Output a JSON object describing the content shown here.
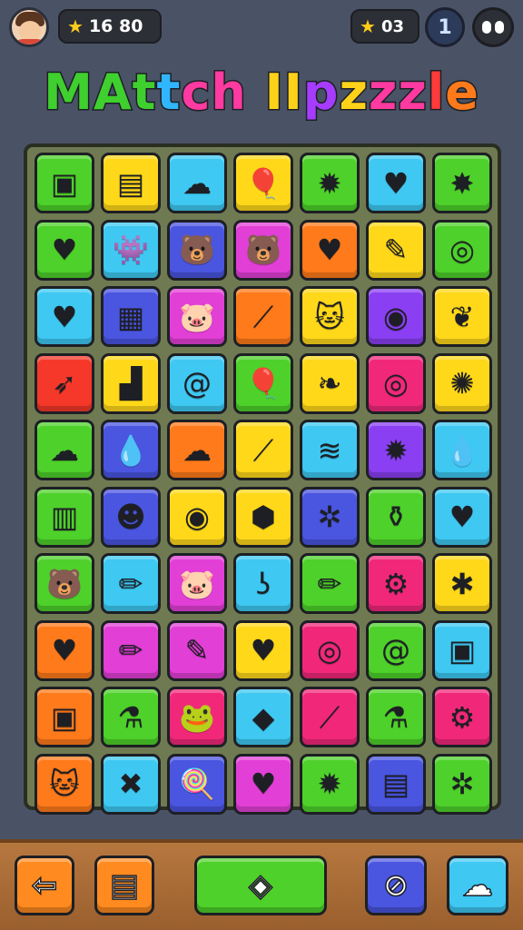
{
  "hud": {
    "score_text": "16 80",
    "stars_text": "03",
    "level_text": "1"
  },
  "title": {
    "letters": [
      {
        "ch": "M",
        "color": "#3fcf2f"
      },
      {
        "ch": "A",
        "color": "#3fcf2f"
      },
      {
        "ch": "t",
        "color": "#3fcf2f"
      },
      {
        "ch": "t",
        "color": "#2fb6ff"
      },
      {
        "ch": "c",
        "color": "#ff3aa0"
      },
      {
        "ch": "h",
        "color": "#ff3aa0"
      },
      {
        "ch": " ",
        "color": "#ffffff"
      },
      {
        "ch": "I",
        "color": "#ffd21a"
      },
      {
        "ch": "I",
        "color": "#ffd21a"
      },
      {
        "ch": "p",
        "color": "#a63cff"
      },
      {
        "ch": "z",
        "color": "#ffd21a"
      },
      {
        "ch": "z",
        "color": "#ff3aa0"
      },
      {
        "ch": "z",
        "color": "#ff3aa0"
      },
      {
        "ch": "l",
        "color": "#ff3a3a"
      },
      {
        "ch": "e",
        "color": "#ff7a1a"
      }
    ]
  },
  "colors": {
    "green": "#4ed12a",
    "yellow": "#ffd81a",
    "cyan": "#3ec8f2",
    "blue": "#4a55e0",
    "pink": "#e23fd6",
    "magenta": "#f1287a",
    "orange": "#ff7a1a",
    "red": "#f5382a",
    "purple": "#8a3ff2"
  },
  "board": {
    "rows": [
      [
        {
          "color": "green",
          "icon": "squares-icon",
          "glyph": "▣"
        },
        {
          "color": "yellow",
          "icon": "frame-icon",
          "glyph": "▤"
        },
        {
          "color": "cyan",
          "icon": "cloud-icon",
          "glyph": "☁"
        },
        {
          "color": "yellow",
          "icon": "balloon-icon",
          "glyph": "🎈"
        },
        {
          "color": "green",
          "icon": "splat-icon",
          "glyph": "✹"
        },
        {
          "color": "cyan",
          "icon": "heart-icon",
          "glyph": "♥"
        },
        {
          "color": "green",
          "icon": "star-burst-icon",
          "glyph": "✸"
        }
      ],
      [
        {
          "color": "green",
          "icon": "heart-icon",
          "glyph": "♥"
        },
        {
          "color": "cyan",
          "icon": "monster-icon",
          "glyph": "👾"
        },
        {
          "color": "blue",
          "icon": "bear-icon",
          "glyph": "🐻"
        },
        {
          "color": "pink",
          "icon": "bear-icon",
          "glyph": "🐻"
        },
        {
          "color": "orange",
          "icon": "heart-icon",
          "glyph": "♥"
        },
        {
          "color": "yellow",
          "icon": "pencil-icon",
          "glyph": "✎"
        },
        {
          "color": "green",
          "icon": "target-icon",
          "glyph": "◎"
        }
      ],
      [
        {
          "color": "cyan",
          "icon": "heart-icon",
          "glyph": "♥"
        },
        {
          "color": "blue",
          "icon": "picture-icon",
          "glyph": "▦"
        },
        {
          "color": "pink",
          "icon": "pig-icon",
          "glyph": "🐷"
        },
        {
          "color": "orange",
          "icon": "wand-icon",
          "glyph": "⟋"
        },
        {
          "color": "yellow",
          "icon": "cat-icon",
          "glyph": "🐱"
        },
        {
          "color": "purple",
          "icon": "ring-icon",
          "glyph": "◉"
        },
        {
          "color": "yellow",
          "icon": "leaf-icon",
          "glyph": "❦"
        }
      ],
      [
        {
          "color": "red",
          "icon": "pencil-tip-icon",
          "glyph": "➶"
        },
        {
          "color": "yellow",
          "icon": "building-icon",
          "glyph": "▟"
        },
        {
          "color": "cyan",
          "icon": "spiral-icon",
          "glyph": "@"
        },
        {
          "color": "green",
          "icon": "balloon-icon",
          "glyph": "🎈"
        },
        {
          "color": "yellow",
          "icon": "leaf-icon",
          "glyph": "❧"
        },
        {
          "color": "magenta",
          "icon": "target-icon",
          "glyph": "◎"
        },
        {
          "color": "yellow",
          "icon": "splat-icon",
          "glyph": "✺"
        }
      ],
      [
        {
          "color": "green",
          "icon": "cloud-icon",
          "glyph": "☁"
        },
        {
          "color": "blue",
          "icon": "drop-icon",
          "glyph": "💧"
        },
        {
          "color": "orange",
          "icon": "chef-hat-icon",
          "glyph": "☁"
        },
        {
          "color": "yellow",
          "icon": "pen-icon",
          "glyph": "⟋"
        },
        {
          "color": "cyan",
          "icon": "swirl-icon",
          "glyph": "≋"
        },
        {
          "color": "purple",
          "icon": "sun-icon",
          "glyph": "✹"
        },
        {
          "color": "cyan",
          "icon": "drop-icon",
          "glyph": "💧"
        }
      ],
      [
        {
          "color": "green",
          "icon": "battery-icon",
          "glyph": "▥"
        },
        {
          "color": "blue",
          "icon": "face-icon",
          "glyph": "☻"
        },
        {
          "color": "yellow",
          "icon": "spiral-icon",
          "glyph": "◉"
        },
        {
          "color": "yellow",
          "icon": "tag-icon",
          "glyph": "⬢"
        },
        {
          "color": "blue",
          "icon": "gear-icon",
          "glyph": "✲"
        },
        {
          "color": "green",
          "icon": "pot-icon",
          "glyph": "⚱"
        },
        {
          "color": "cyan",
          "icon": "heart-icon",
          "glyph": "♥"
        }
      ],
      [
        {
          "color": "green",
          "icon": "bear-icon",
          "glyph": "🐻"
        },
        {
          "color": "cyan",
          "icon": "crayon-icon",
          "glyph": "✏"
        },
        {
          "color": "pink",
          "icon": "pig-icon",
          "glyph": "🐷"
        },
        {
          "color": "cyan",
          "icon": "hook-icon",
          "glyph": "ʖ"
        },
        {
          "color": "green",
          "icon": "pencil-icon",
          "glyph": "✏"
        },
        {
          "color": "magenta",
          "icon": "gear-icon",
          "glyph": "⚙"
        },
        {
          "color": "yellow",
          "icon": "star-icon",
          "glyph": "✱"
        }
      ],
      [
        {
          "color": "orange",
          "icon": "heart-icon",
          "glyph": "♥"
        },
        {
          "color": "pink",
          "icon": "pencil-icon",
          "glyph": "✏"
        },
        {
          "color": "pink",
          "icon": "pencil-icon",
          "glyph": "✎"
        },
        {
          "color": "yellow",
          "icon": "heart-icon",
          "glyph": "♥"
        },
        {
          "color": "magenta",
          "icon": "spiral-icon",
          "glyph": "◎"
        },
        {
          "color": "green",
          "icon": "spiral-icon",
          "glyph": "@"
        },
        {
          "color": "cyan",
          "icon": "card-icon",
          "glyph": "▣"
        }
      ],
      [
        {
          "color": "orange",
          "icon": "camera-icon",
          "glyph": "▣"
        },
        {
          "color": "green",
          "icon": "bottle-icon",
          "glyph": "⚗"
        },
        {
          "color": "magenta",
          "icon": "frog-icon",
          "glyph": "🐸"
        },
        {
          "color": "cyan",
          "icon": "gem-icon",
          "glyph": "◆"
        },
        {
          "color": "magenta",
          "icon": "pen-icon",
          "glyph": "⟋"
        },
        {
          "color": "green",
          "icon": "bottle-icon",
          "glyph": "⚗"
        },
        {
          "color": "magenta",
          "icon": "gear-icon",
          "glyph": "⚙"
        }
      ],
      [
        {
          "color": "orange",
          "icon": "cat-icon",
          "glyph": "🐱"
        },
        {
          "color": "cyan",
          "icon": "cross-icon",
          "glyph": "✖"
        },
        {
          "color": "blue",
          "icon": "lollipop-icon",
          "glyph": "🍭"
        },
        {
          "color": "pink",
          "icon": "heart-icon",
          "glyph": "♥"
        },
        {
          "color": "green",
          "icon": "splat-icon",
          "glyph": "✹"
        },
        {
          "color": "blue",
          "icon": "ruler-icon",
          "glyph": "▤"
        },
        {
          "color": "green",
          "icon": "gear-icon",
          "glyph": "✲"
        }
      ]
    ]
  },
  "bottom": {
    "buttons": [
      {
        "name": "back-button",
        "icon": "arrow-left-icon",
        "glyph": "⇦",
        "bg": "#ff8a1f"
      },
      {
        "name": "inventory-button",
        "icon": "box-icon",
        "glyph": "▤",
        "bg": "#ff8a1f"
      },
      {
        "name": "hint-button",
        "icon": "cube-icon",
        "glyph": "◈",
        "bg": "#4ed12a"
      },
      {
        "name": "shuffle-button",
        "icon": "no-entry-icon",
        "glyph": "⊘",
        "bg": "#4a55e0"
      },
      {
        "name": "powerup-button",
        "icon": "cloud-icon",
        "glyph": "☁",
        "bg": "#3ec8f2"
      }
    ]
  }
}
